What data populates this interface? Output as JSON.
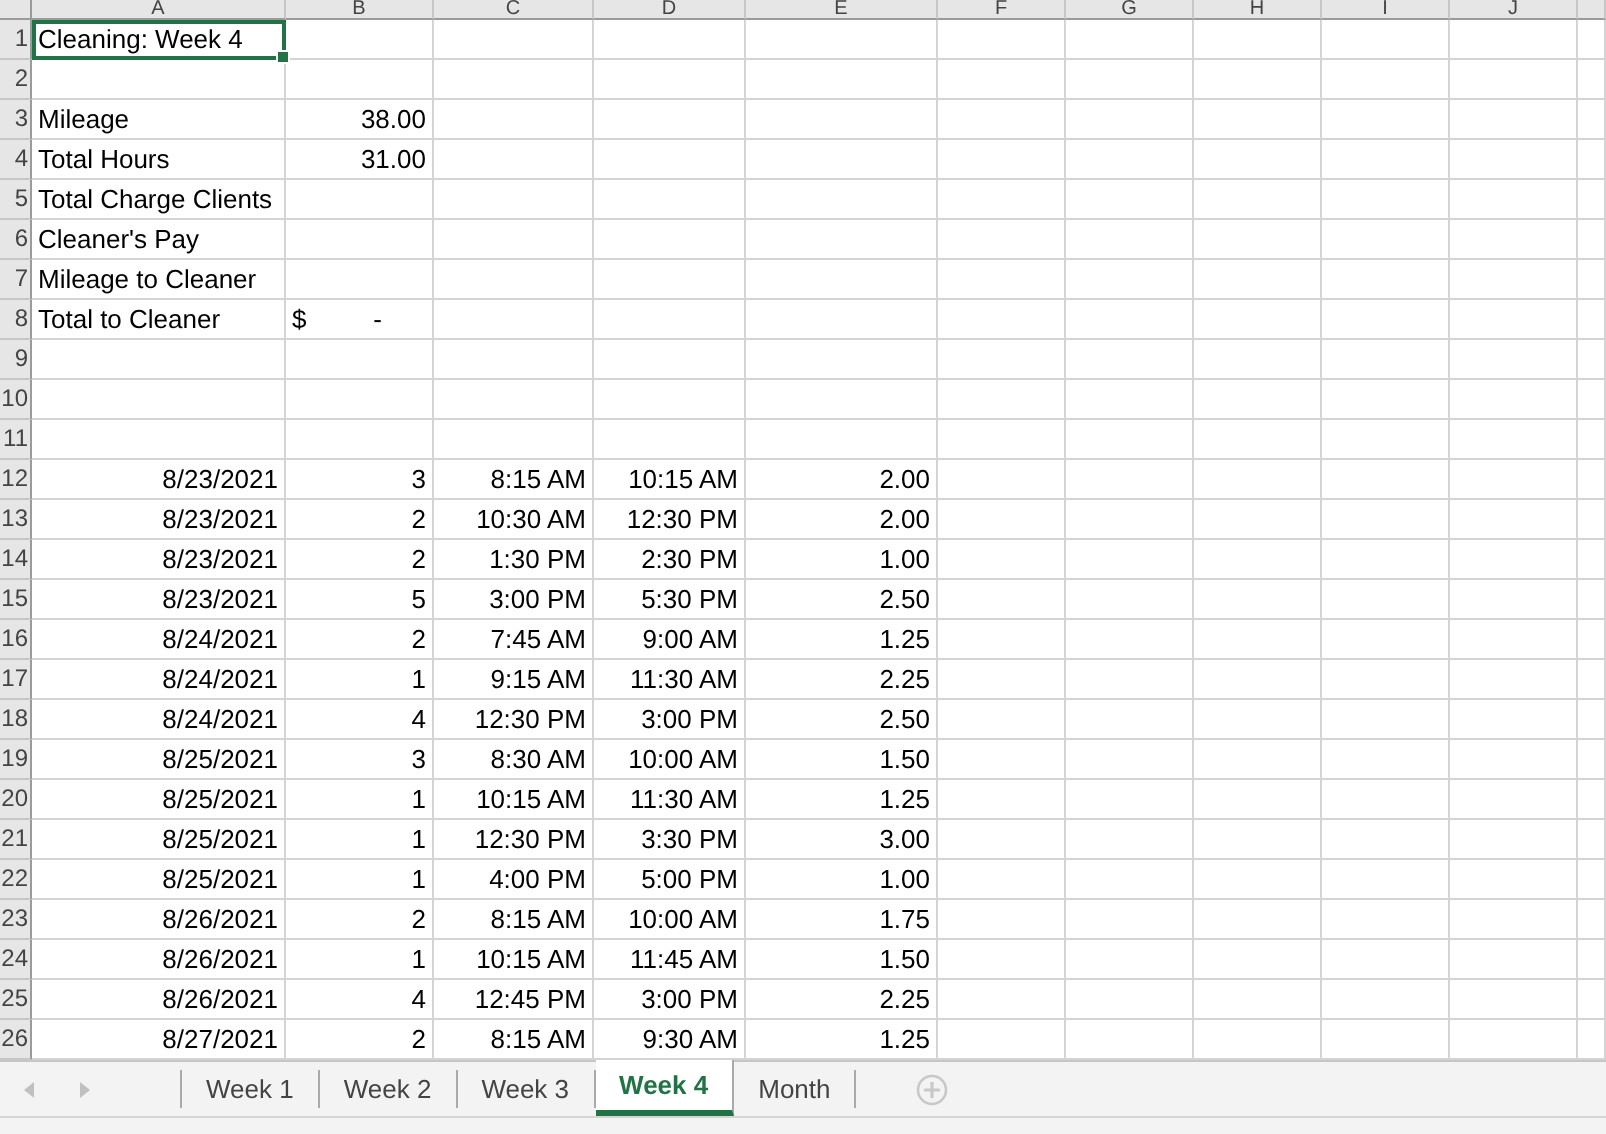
{
  "columns": [
    "A",
    "B",
    "C",
    "D",
    "E",
    "F",
    "G",
    "H",
    "I",
    "J"
  ],
  "rows": [
    {
      "number": "1",
      "cells": [
        {
          "kind": "label",
          "text": "Cleaning: Week 4",
          "selected": true
        }
      ]
    },
    {
      "number": "2",
      "cells": []
    },
    {
      "number": "3",
      "cells": [
        {
          "kind": "label",
          "text": "Mileage",
          "selected": false
        },
        {
          "kind": "value",
          "text": "38.00",
          "selected": false
        }
      ]
    },
    {
      "number": "4",
      "cells": [
        {
          "kind": "label",
          "text": "Total Hours",
          "selected": false
        },
        {
          "kind": "value",
          "text": "31.00",
          "selected": false
        }
      ]
    },
    {
      "number": "5",
      "cells": [
        {
          "kind": "label",
          "text": "Total Charge Clients",
          "selected": false
        }
      ]
    },
    {
      "number": "6",
      "cells": [
        {
          "kind": "label",
          "text": "Cleaner's Pay",
          "selected": false
        }
      ]
    },
    {
      "number": "7",
      "cells": [
        {
          "kind": "label",
          "text": "Mileage to Cleaner",
          "selected": false
        }
      ]
    },
    {
      "number": "8",
      "cells": [
        {
          "kind": "label",
          "text": "Total to Cleaner",
          "selected": false
        },
        {
          "kind": "currency",
          "symbol": "$",
          "text": "-",
          "selected": false
        }
      ]
    },
    {
      "number": "9",
      "cells": []
    },
    {
      "number": "10",
      "cells": []
    },
    {
      "number": "11",
      "cells": []
    },
    {
      "number": "12",
      "cells": [
        {
          "kind": "value",
          "text": "8/23/2021",
          "selected": false
        },
        {
          "kind": "value",
          "text": "3",
          "selected": false
        },
        {
          "kind": "value",
          "text": "8:15 AM",
          "selected": false
        },
        {
          "kind": "value",
          "text": "10:15 AM",
          "selected": false
        },
        {
          "kind": "value",
          "text": "2.00",
          "selected": false
        }
      ]
    },
    {
      "number": "13",
      "cells": [
        {
          "kind": "value",
          "text": "8/23/2021",
          "selected": false
        },
        {
          "kind": "value",
          "text": "2",
          "selected": false
        },
        {
          "kind": "value",
          "text": "10:30 AM",
          "selected": false
        },
        {
          "kind": "value",
          "text": "12:30 PM",
          "selected": false
        },
        {
          "kind": "value",
          "text": "2.00",
          "selected": false
        }
      ]
    },
    {
      "number": "14",
      "cells": [
        {
          "kind": "value",
          "text": "8/23/2021",
          "selected": false
        },
        {
          "kind": "value",
          "text": "2",
          "selected": false
        },
        {
          "kind": "value",
          "text": "1:30 PM",
          "selected": false
        },
        {
          "kind": "value",
          "text": "2:30 PM",
          "selected": false
        },
        {
          "kind": "value",
          "text": "1.00",
          "selected": false
        }
      ]
    },
    {
      "number": "15",
      "cells": [
        {
          "kind": "value",
          "text": "8/23/2021",
          "selected": false
        },
        {
          "kind": "value",
          "text": "5",
          "selected": false
        },
        {
          "kind": "value",
          "text": "3:00 PM",
          "selected": false
        },
        {
          "kind": "value",
          "text": "5:30 PM",
          "selected": false
        },
        {
          "kind": "value",
          "text": "2.50",
          "selected": false
        }
      ]
    },
    {
      "number": "16",
      "cells": [
        {
          "kind": "value",
          "text": "8/24/2021",
          "selected": false
        },
        {
          "kind": "value",
          "text": "2",
          "selected": false
        },
        {
          "kind": "value",
          "text": "7:45 AM",
          "selected": false
        },
        {
          "kind": "value",
          "text": "9:00 AM",
          "selected": false
        },
        {
          "kind": "value",
          "text": "1.25",
          "selected": false
        }
      ]
    },
    {
      "number": "17",
      "cells": [
        {
          "kind": "value",
          "text": "8/24/2021",
          "selected": false
        },
        {
          "kind": "value",
          "text": "1",
          "selected": false
        },
        {
          "kind": "value",
          "text": "9:15 AM",
          "selected": false
        },
        {
          "kind": "value",
          "text": "11:30 AM",
          "selected": false
        },
        {
          "kind": "value",
          "text": "2.25",
          "selected": false
        }
      ]
    },
    {
      "number": "18",
      "cells": [
        {
          "kind": "value",
          "text": "8/24/2021",
          "selected": false
        },
        {
          "kind": "value",
          "text": "4",
          "selected": false
        },
        {
          "kind": "value",
          "text": "12:30 PM",
          "selected": false
        },
        {
          "kind": "value",
          "text": "3:00 PM",
          "selected": false
        },
        {
          "kind": "value",
          "text": "2.50",
          "selected": false
        }
      ]
    },
    {
      "number": "19",
      "cells": [
        {
          "kind": "value",
          "text": "8/25/2021",
          "selected": false
        },
        {
          "kind": "value",
          "text": "3",
          "selected": false
        },
        {
          "kind": "value",
          "text": "8:30 AM",
          "selected": false
        },
        {
          "kind": "value",
          "text": "10:00 AM",
          "selected": false
        },
        {
          "kind": "value",
          "text": "1.50",
          "selected": false
        }
      ]
    },
    {
      "number": "20",
      "cells": [
        {
          "kind": "value",
          "text": "8/25/2021",
          "selected": false
        },
        {
          "kind": "value",
          "text": "1",
          "selected": false
        },
        {
          "kind": "value",
          "text": "10:15 AM",
          "selected": false
        },
        {
          "kind": "value",
          "text": "11:30 AM",
          "selected": false
        },
        {
          "kind": "value",
          "text": "1.25",
          "selected": false
        }
      ]
    },
    {
      "number": "21",
      "cells": [
        {
          "kind": "value",
          "text": "8/25/2021",
          "selected": false
        },
        {
          "kind": "value",
          "text": "1",
          "selected": false
        },
        {
          "kind": "value",
          "text": "12:30 PM",
          "selected": false
        },
        {
          "kind": "value",
          "text": "3:30 PM",
          "selected": false
        },
        {
          "kind": "value",
          "text": "3.00",
          "selected": false
        }
      ]
    },
    {
      "number": "22",
      "cells": [
        {
          "kind": "value",
          "text": "8/25/2021",
          "selected": false
        },
        {
          "kind": "value",
          "text": "1",
          "selected": false
        },
        {
          "kind": "value",
          "text": "4:00 PM",
          "selected": false
        },
        {
          "kind": "value",
          "text": "5:00 PM",
          "selected": false
        },
        {
          "kind": "value",
          "text": "1.00",
          "selected": false
        }
      ]
    },
    {
      "number": "23",
      "cells": [
        {
          "kind": "value",
          "text": "8/26/2021",
          "selected": false
        },
        {
          "kind": "value",
          "text": "2",
          "selected": false
        },
        {
          "kind": "value",
          "text": "8:15 AM",
          "selected": false
        },
        {
          "kind": "value",
          "text": "10:00 AM",
          "selected": false
        },
        {
          "kind": "value",
          "text": "1.75",
          "selected": false
        }
      ]
    },
    {
      "number": "24",
      "cells": [
        {
          "kind": "value",
          "text": "8/26/2021",
          "selected": false
        },
        {
          "kind": "value",
          "text": "1",
          "selected": false
        },
        {
          "kind": "value",
          "text": "10:15 AM",
          "selected": false
        },
        {
          "kind": "value",
          "text": "11:45 AM",
          "selected": false
        },
        {
          "kind": "value",
          "text": "1.50",
          "selected": false
        }
      ]
    },
    {
      "number": "25",
      "cells": [
        {
          "kind": "value",
          "text": "8/26/2021",
          "selected": false
        },
        {
          "kind": "value",
          "text": "4",
          "selected": false
        },
        {
          "kind": "value",
          "text": "12:45 PM",
          "selected": false
        },
        {
          "kind": "value",
          "text": "3:00 PM",
          "selected": false
        },
        {
          "kind": "value",
          "text": "2.25",
          "selected": false
        }
      ]
    },
    {
      "number": "26",
      "cells": [
        {
          "kind": "value",
          "text": "8/27/2021",
          "selected": false
        },
        {
          "kind": "value",
          "text": "2",
          "selected": false
        },
        {
          "kind": "value",
          "text": "8:15 AM",
          "selected": false
        },
        {
          "kind": "value",
          "text": "9:30 AM",
          "selected": false
        },
        {
          "kind": "value",
          "text": "1.25",
          "selected": false
        }
      ]
    }
  ],
  "sheet_tabs": [
    {
      "label": "Week 1",
      "selected": false
    },
    {
      "label": "Week 2",
      "selected": false
    },
    {
      "label": "Week 3",
      "selected": false
    },
    {
      "label": "Week 4",
      "selected": true
    },
    {
      "label": "Month",
      "selected": false
    }
  ]
}
